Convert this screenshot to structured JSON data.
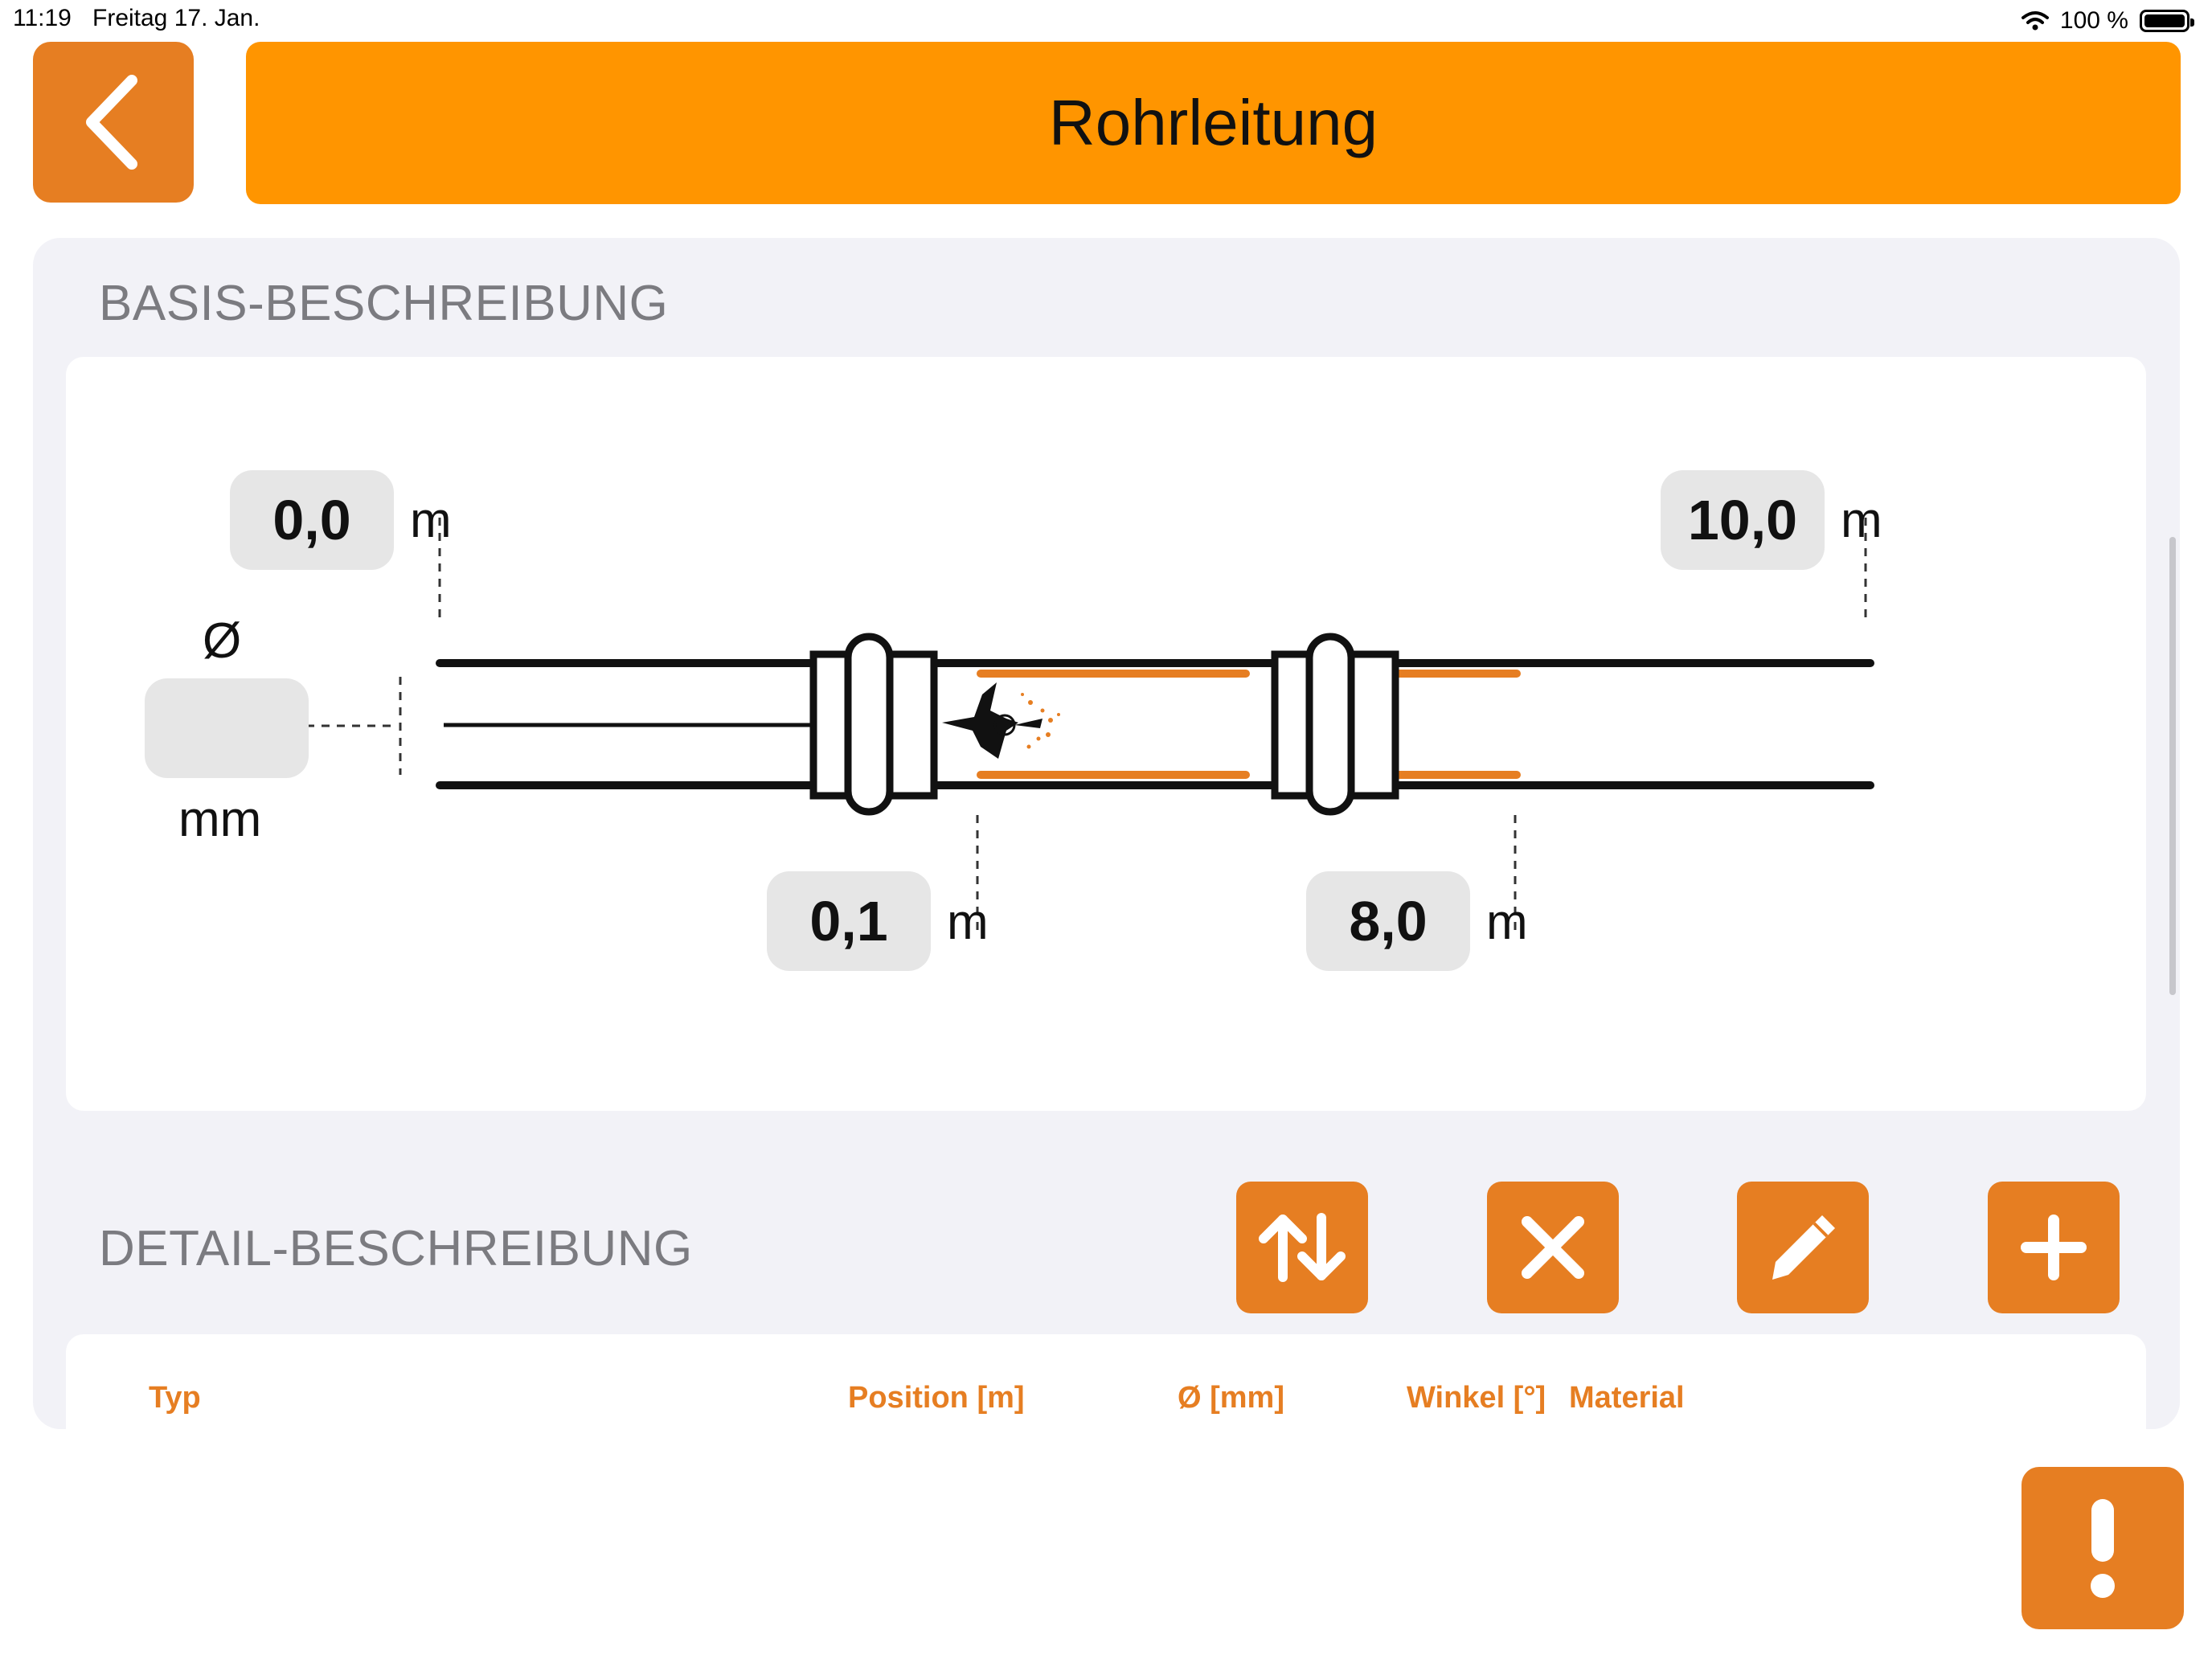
{
  "status_bar": {
    "time": "11:19",
    "date": "Freitag 17. Jan.",
    "battery": "100 %"
  },
  "header": {
    "title": "Rohrleitung"
  },
  "basis": {
    "section_title": "BASIS-BESCHREIBUNG",
    "start_value": "0,0",
    "end_value": "10,0",
    "marker1_value": "0,1",
    "marker2_value": "8,0",
    "unit_m": "m",
    "diameter_symbol": "Ø",
    "diameter_value": "",
    "diameter_unit": "mm"
  },
  "detail": {
    "section_title": "DETAIL-BESCHREIBUNG",
    "columns": [
      "Typ",
      "Position [m]",
      "Ø [mm]",
      "Winkel [°]",
      "Material"
    ]
  },
  "colors": {
    "accent": "#e67e22",
    "title_bar": "#ff9500",
    "panel": "#f2f2f7",
    "field": "#e6e6e6"
  }
}
